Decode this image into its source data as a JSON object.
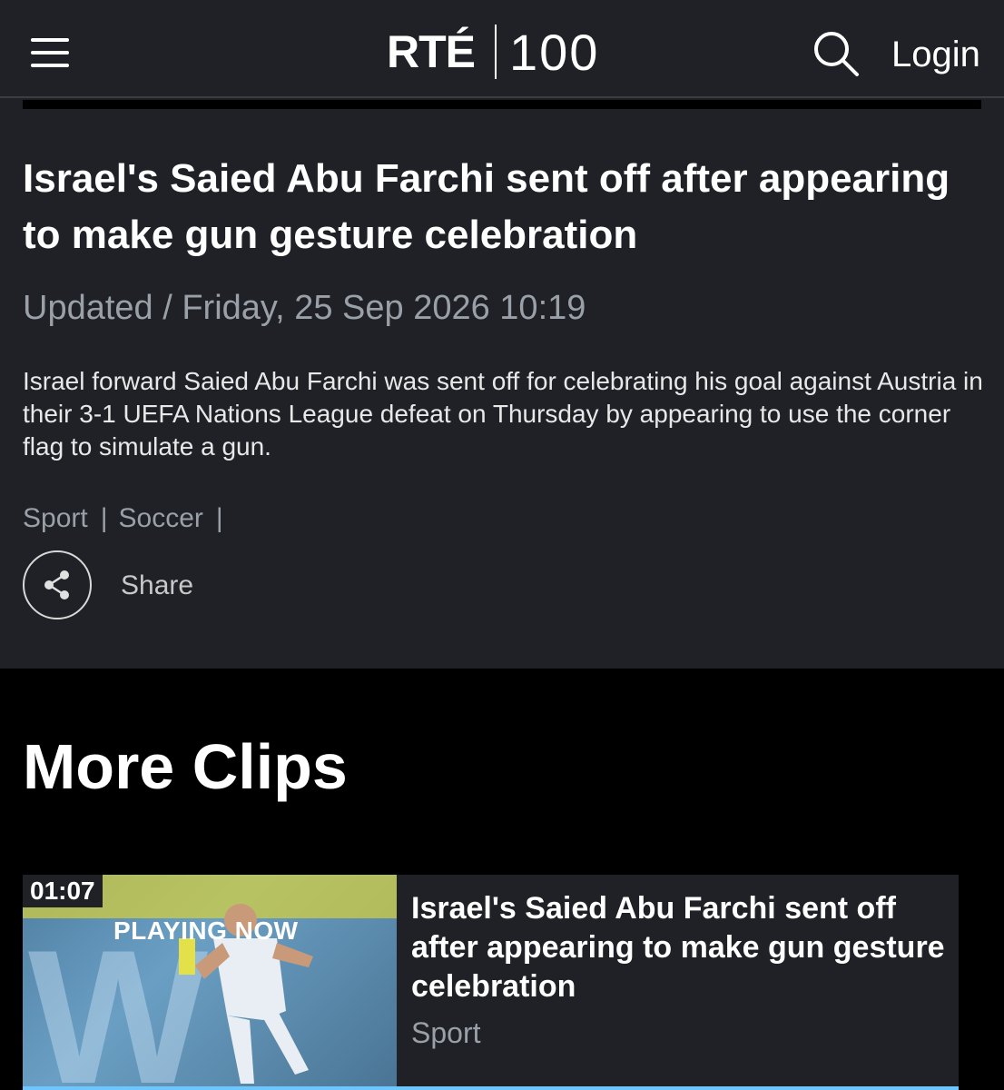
{
  "header": {
    "logo_rte": "RTÉ",
    "logo_100": "100",
    "login_label": "Login"
  },
  "article": {
    "title": "Israel's Saied Abu Farchi sent off after appearing to make gun gesture celebration",
    "updated": "Updated / Friday, 25 Sep 2026 10:19",
    "summary": "Israel forward Saied Abu Farchi was sent off for celebrating his goal against Austria in their 3-1 UEFA Nations League defeat on Thursday by appearing to use the corner flag to simulate a gun.",
    "tags": [
      "Sport",
      "Soccer"
    ],
    "share_label": "Share"
  },
  "more_clips": {
    "heading": "More Clips",
    "items": [
      {
        "duration": "01:07",
        "status": "PLAYING NOW",
        "title": "Israel's Saied Abu Farchi sent off after appearing to make gun gesture celebration",
        "category": "Sport"
      }
    ]
  },
  "icons": {
    "menu": "hamburger-menu-icon",
    "search": "search-icon",
    "share": "share-icon"
  },
  "colors": {
    "header_bg": "#1f2126",
    "page_bg": "#000000",
    "muted_text": "#9aa0a8",
    "progress_accent": "#6ec6ff"
  }
}
